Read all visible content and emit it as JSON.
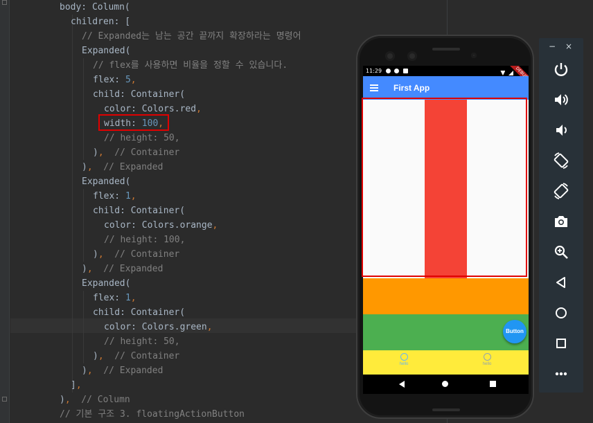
{
  "editor": {
    "lines": [
      [
        {
          "t": "body: Column(",
          "c": "plain"
        }
      ],
      [
        {
          "t": "children: [",
          "c": "plain"
        }
      ],
      [
        {
          "t": "// Expanded는 남는 공간 끝까지 확장하라는 명령어",
          "c": "cmt"
        }
      ],
      [
        {
          "t": "Expanded(",
          "c": "plain"
        }
      ],
      [
        {
          "t": "// flex를 사용하면 비율을 정할 수 있습니다.",
          "c": "cmt"
        }
      ],
      [
        {
          "t": "flex: ",
          "c": "plain"
        },
        {
          "t": "5",
          "c": "num"
        },
        {
          "t": ",",
          "c": "punc"
        }
      ],
      [
        {
          "t": "child: Container(",
          "c": "plain"
        }
      ],
      [
        {
          "t": "color: Colors.red",
          "c": "plain"
        },
        {
          "t": ",",
          "c": "punc"
        }
      ],
      [
        {
          "t": "width: ",
          "c": "plain"
        },
        {
          "t": "100",
          "c": "num"
        },
        {
          "t": ",",
          "c": "punc"
        }
      ],
      [
        {
          "t": "// height: 50,",
          "c": "cmt"
        }
      ],
      [
        {
          "t": ")",
          "c": "plain"
        },
        {
          "t": ",",
          "c": "punc"
        },
        {
          "t": "  // Container",
          "c": "cmt"
        }
      ],
      [
        {
          "t": ")",
          "c": "plain"
        },
        {
          "t": ",",
          "c": "punc"
        },
        {
          "t": "  // Expanded",
          "c": "cmt"
        }
      ],
      [
        {
          "t": "Expanded(",
          "c": "plain"
        }
      ],
      [
        {
          "t": "flex: ",
          "c": "plain"
        },
        {
          "t": "1",
          "c": "num"
        },
        {
          "t": ",",
          "c": "punc"
        }
      ],
      [
        {
          "t": "child: Container(",
          "c": "plain"
        }
      ],
      [
        {
          "t": "color: Colors.orange",
          "c": "plain"
        },
        {
          "t": ",",
          "c": "punc"
        }
      ],
      [
        {
          "t": "// height: 100,",
          "c": "cmt"
        }
      ],
      [
        {
          "t": ")",
          "c": "plain"
        },
        {
          "t": ",",
          "c": "punc"
        },
        {
          "t": "  // Container",
          "c": "cmt"
        }
      ],
      [
        {
          "t": ")",
          "c": "plain"
        },
        {
          "t": ",",
          "c": "punc"
        },
        {
          "t": "  // Expanded",
          "c": "cmt"
        }
      ],
      [
        {
          "t": "Expanded(",
          "c": "plain"
        }
      ],
      [
        {
          "t": "flex: ",
          "c": "plain"
        },
        {
          "t": "1",
          "c": "num"
        },
        {
          "t": ",",
          "c": "punc"
        }
      ],
      [
        {
          "t": "child: Container(",
          "c": "plain"
        }
      ],
      [
        {
          "t": "color: Colors.green",
          "c": "plain"
        },
        {
          "t": ",",
          "c": "punc"
        }
      ],
      [
        {
          "t": "// height: 50,",
          "c": "cmt"
        }
      ],
      [
        {
          "t": ")",
          "c": "plain"
        },
        {
          "t": ",",
          "c": "punc"
        },
        {
          "t": "  // Container",
          "c": "cmt"
        }
      ],
      [
        {
          "t": ")",
          "c": "plain"
        },
        {
          "t": ",",
          "c": "punc"
        },
        {
          "t": "  // Expanded",
          "c": "cmt"
        }
      ],
      [
        {
          "t": "]",
          "c": "plain"
        },
        {
          "t": ",",
          "c": "punc"
        }
      ],
      [
        {
          "t": ")",
          "c": "plain"
        },
        {
          "t": ",",
          "c": "punc"
        },
        {
          "t": "  // Column",
          "c": "cmt"
        }
      ],
      [
        {
          "t": "// 기본 구조 3. floatingActionButton",
          "c": "cmt"
        }
      ]
    ]
  },
  "phone": {
    "status_time": "11:29",
    "debug_banner": "DEBUG",
    "app_title": "First App",
    "fab_label": "Button",
    "nav_items": [
      {
        "label": "hello",
        "icon": "alarm-icon"
      },
      {
        "label": "hello",
        "icon": "alarm-icon"
      }
    ]
  },
  "colors": {
    "red": "#f44336",
    "orange": "#ff9800",
    "green": "#4caf50",
    "yellow": "#ffeb3b",
    "appbar": "#448aff",
    "fab": "#2196f3",
    "highlight": "#e00000"
  },
  "emulator": {
    "minimize_label": "−",
    "close_label": "×",
    "buttons": [
      "power-icon",
      "volume-up-icon",
      "volume-down-icon",
      "rotate-left-icon",
      "rotate-right-icon",
      "camera-icon",
      "zoom-icon",
      "back-icon",
      "home-icon",
      "overview-icon",
      "more-icon"
    ]
  }
}
